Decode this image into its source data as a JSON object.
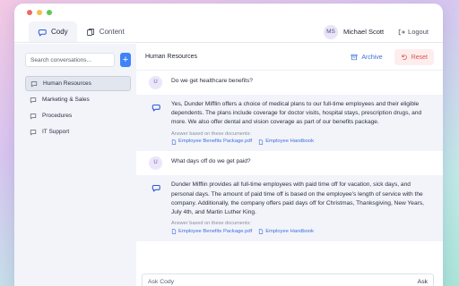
{
  "window": {
    "traffic_lights": [
      "#ee6a5f",
      "#f5be4f",
      "#62c554"
    ]
  },
  "nav": {
    "tabs": [
      {
        "label": "Cody",
        "icon": "chat-bubble-icon",
        "active": true
      },
      {
        "label": "Content",
        "icon": "documents-icon",
        "active": false
      }
    ],
    "user": {
      "initials": "MS",
      "name": "Michael Scott"
    },
    "logout_label": "Logout"
  },
  "sidebar": {
    "search_placeholder": "Search conversations...",
    "add_label": "+",
    "conversations": [
      {
        "label": "Human Resources",
        "active": true
      },
      {
        "label": "Marketing & Sales",
        "active": false
      },
      {
        "label": "Procedures",
        "active": false
      },
      {
        "label": "IT Support",
        "active": false
      }
    ]
  },
  "main": {
    "title": "Human Resources",
    "archive_label": "Archive",
    "reset_label": "Reset",
    "messages": [
      {
        "role": "user",
        "avatar": "U",
        "text": "Do we get healthcare benefits?"
      },
      {
        "role": "bot",
        "text": "Yes, Dunder Mifflin offers a choice of medical plans to our full-time employees and their eligible dependents. The plans include coverage for doctor visits, hospital stays, prescription drugs, and more. We also offer dental and vision coverage as part of our benefits package.",
        "sources_label": "Answer based on these documents:",
        "sources": [
          "Employee Benefits Package.pdf",
          "Employee Handbook"
        ]
      },
      {
        "role": "user",
        "avatar": "U",
        "text": "What days off do we get paid?"
      },
      {
        "role": "bot",
        "text": "Dunder Mifflin provides all full-time employees with paid time off for vacation, sick days, and personal days. The amount of paid time off is based on the employee's length of service with the company. Additionally, the company offers paid days off for Christmas, Thanksgiving, New Years, July 4th, and Martin Luther King.",
        "sources_label": "Answer based on these documents:",
        "sources": [
          "Employee Benefits Package.pdf",
          "Employee Handbook"
        ]
      }
    ],
    "ask_placeholder": "Ask Cody",
    "ask_button": "Ask"
  }
}
